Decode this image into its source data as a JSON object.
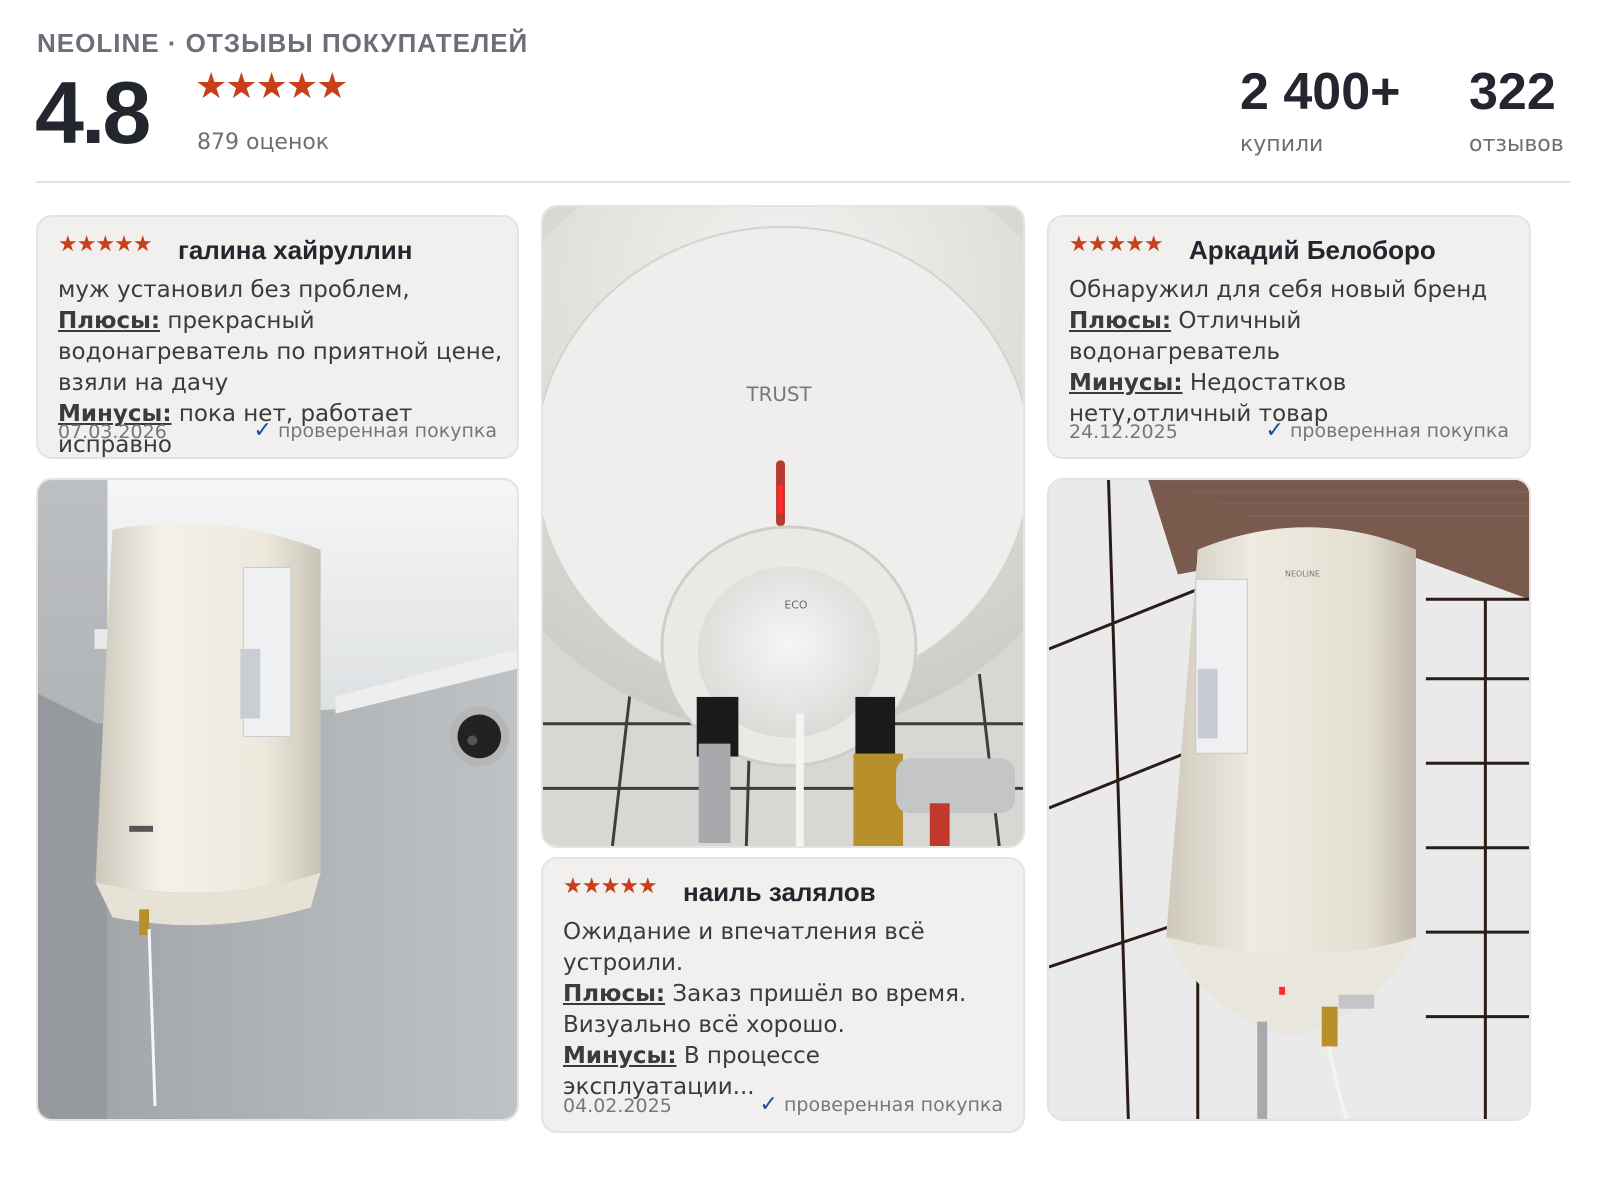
{
  "header": {
    "brand": "NEOLINE · ОТЗЫВЫ ПОКУПАТЕЛЕЙ",
    "rating": "4.8",
    "stars": "★★★★★",
    "ratings_count": "879 оценок",
    "bought_value": "2 400+",
    "bought_label": "купили",
    "reviews_value": "322",
    "reviews_label": "отзывов"
  },
  "reviews": [
    {
      "stars": "★★★★★",
      "author": "галина хайруллин",
      "text": "муж установил без проблем,",
      "pros_label": "Плюсы:",
      "pros": "прекрасный водонагреватель по приятной цене, взяли на дачу",
      "cons_label": "Минусы:",
      "cons": "пока нет, работает исправно",
      "date": "07.03.2026",
      "verified": "проверенная покупка"
    },
    {
      "stars": "★★★★★",
      "author": "Аркадий Белоборо",
      "text": "Обнаружил для себя новый бренд",
      "pros_label": "Плюсы:",
      "pros": "Отличный водонагреватель",
      "cons_label": "Минусы:",
      "cons": "Недостатков нету,отличный товар",
      "date": "24.12.2025",
      "verified": "проверенная покупка"
    },
    {
      "stars": "★★★★★",
      "author": "наиль залялов",
      "text": "Ожидание и впечатления всё устроили.",
      "pros_label": "Плюсы:",
      "pros": "Заказ пришёл во время. Визуально всё хорошо.",
      "cons_label": "Минусы:",
      "cons": "В процессе эксплуатации...",
      "date": "04.02.2025",
      "verified": "проверенная покупка"
    }
  ],
  "photos": {
    "middle_logo": "TRUST",
    "middle_eco": "ECO",
    "right_logo": "NEOLINE"
  },
  "colors": {
    "star": "#c8401a",
    "verified_check": "#1d4aa3",
    "card_bg": "#f1f0ee"
  }
}
